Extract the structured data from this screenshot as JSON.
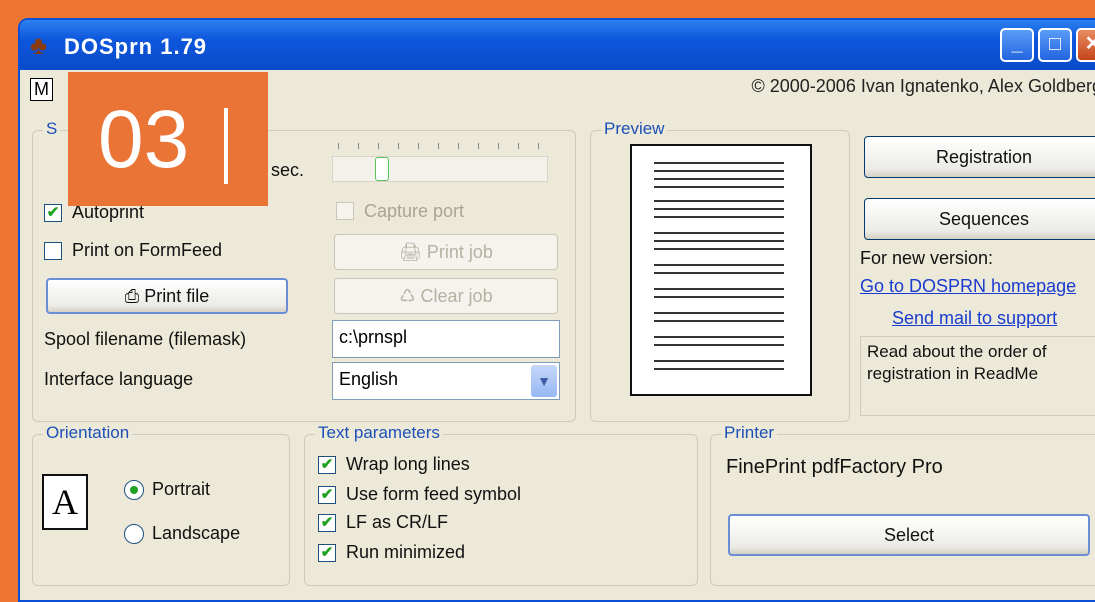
{
  "window": {
    "title": "DOSprn 1.79",
    "controls": {
      "minimize": "_",
      "maximize": "□",
      "close": "✕"
    }
  },
  "menu": {
    "first_item": "M"
  },
  "copyright": "© 2000-2006 Ivan Ignatenko, Alex Goldberg",
  "badge": {
    "number": "03"
  },
  "settings": {
    "legend": "S",
    "timeout_value": "3 sec.",
    "timeout_level": 0.2,
    "autoprint_label": "Autoprint",
    "autoprint_checked": true,
    "print_on_formfeed_label": "Print on FormFeed",
    "print_on_formfeed_checked": false,
    "capture_port_label": "Capture port",
    "print_file_button": "Print file",
    "print_job_button": "Print job",
    "clear_job_button": "Clear job",
    "spool_filename_label": "Spool filename (filemask)",
    "spool_filename_value": "c:\\prnspl",
    "interface_language_label": "Interface language",
    "interface_language_value": "English"
  },
  "preview": {
    "legend": "Preview"
  },
  "side": {
    "registration_button": "Registration",
    "sequences_button": "Sequences",
    "new_version_label": "For new version:",
    "homepage_link": "Go to DOSPRN homepage",
    "mail_link": "Send mail to support",
    "readme_text": "Read about the order of registration in ReadMe"
  },
  "orientation": {
    "legend": "Orientation",
    "icon_letter": "A",
    "portrait_label": "Portrait",
    "landscape_label": "Landscape",
    "selected": "Portrait"
  },
  "text_parameters": {
    "legend": "Text parameters",
    "items": [
      {
        "label": "Wrap long lines",
        "checked": true
      },
      {
        "label": "Use form feed symbol",
        "checked": true
      },
      {
        "label": "LF as CR/LF",
        "checked": true
      },
      {
        "label": "Run minimized",
        "checked": true
      }
    ]
  },
  "printer": {
    "legend": "Printer",
    "name": "FinePrint pdfFactory Pro",
    "select_button": "Select"
  },
  "colors": {
    "background": "#ec7532",
    "titlebar": "#0d56dc",
    "legend": "#1d4fb8",
    "link": "#1a3bd0",
    "check": "#21a121"
  }
}
